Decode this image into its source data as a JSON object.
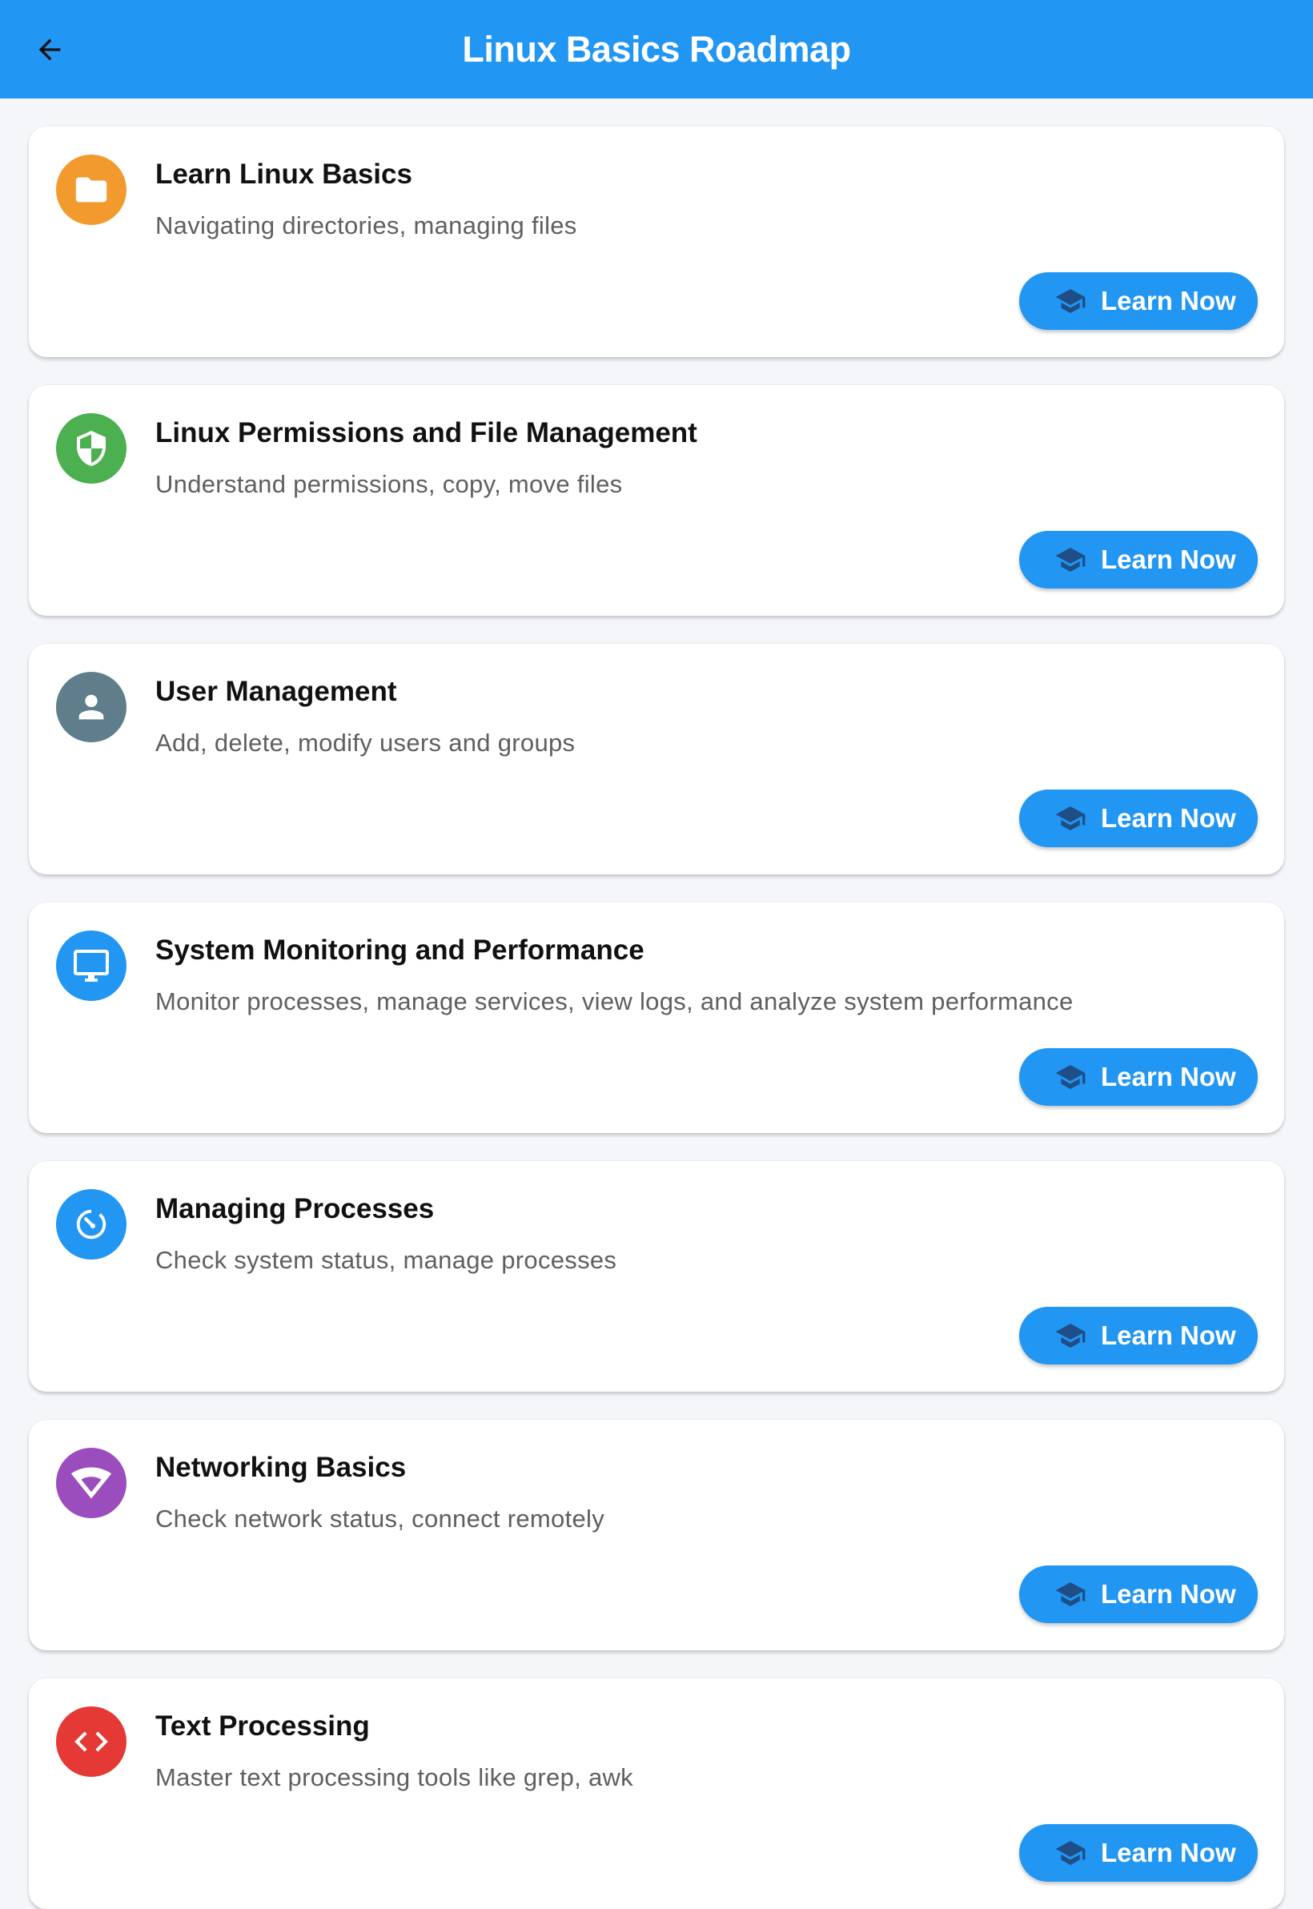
{
  "header": {
    "title": "Linux Basics Roadmap",
    "back_icon": "arrow-back-icon",
    "background": "#2196f3"
  },
  "button_label": "Learn Now",
  "button_icon": "graduation-cap-icon",
  "cards": [
    {
      "title": "Learn Linux Basics",
      "subtitle": "Navigating directories, managing files",
      "icon": "folder-icon",
      "color": "#f39a2e"
    },
    {
      "title": "Linux Permissions and File Management",
      "subtitle": "Understand permissions, copy, move files",
      "icon": "shield-icon",
      "color": "#4caf50"
    },
    {
      "title": "User Management",
      "subtitle": "Add, delete, modify users and groups",
      "icon": "person-icon",
      "color": "#607d8b"
    },
    {
      "title": "System Monitoring and Performance",
      "subtitle": "Monitor processes, manage services, view logs, and analyze system performance",
      "icon": "monitor-icon",
      "color": "#2196f3"
    },
    {
      "title": "Managing Processes",
      "subtitle": "Check system status, manage processes",
      "icon": "timer-icon",
      "color": "#2196f3"
    },
    {
      "title": "Networking Basics",
      "subtitle": "Check network status, connect remotely",
      "icon": "wifi-icon",
      "color": "#9c4dbd"
    },
    {
      "title": "Text Processing",
      "subtitle": "Master text processing tools like grep, awk",
      "icon": "code-icon",
      "color": "#e53935"
    }
  ]
}
